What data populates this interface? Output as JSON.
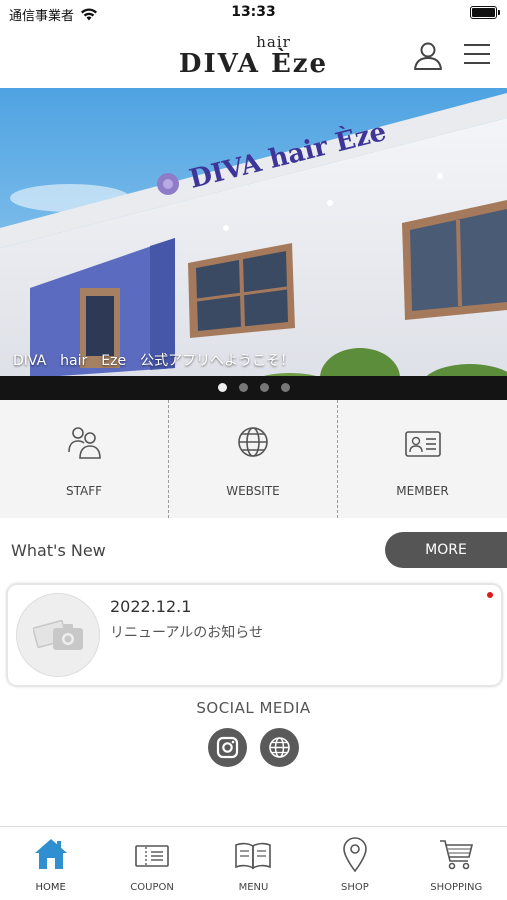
{
  "status_bar": {
    "carrier": "通信事業者",
    "time": "13:33"
  },
  "header": {
    "logo_small": "hair",
    "logo_main": "DIVA Èze"
  },
  "hero": {
    "sign_text": "DIVA hair Èze",
    "caption": "DIVA　hair　Eze　公式アプリへようこそ！",
    "slide_count": 4,
    "active_slide": 1
  },
  "quick_menu": [
    {
      "label": "STAFF",
      "icon": "staff-icon"
    },
    {
      "label": "WEBSITE",
      "icon": "globe-icon"
    },
    {
      "label": "MEMBER",
      "icon": "member-card-icon"
    }
  ],
  "whats_new": {
    "title": "What's New",
    "more_label": "MORE",
    "items": [
      {
        "date": "2022.12.1",
        "text": "リニューアルのお知らせ",
        "unread": true
      }
    ]
  },
  "social": {
    "title": "SOCIAL MEDIA",
    "links": [
      {
        "icon": "instagram-icon"
      },
      {
        "icon": "globe-icon"
      }
    ]
  },
  "tabbar": {
    "active": "HOME",
    "active_color": "#2f8fd0",
    "items": [
      {
        "label": "HOME",
        "icon": "home-icon"
      },
      {
        "label": "COUPON",
        "icon": "coupon-icon"
      },
      {
        "label": "MENU",
        "icon": "book-icon"
      },
      {
        "label": "SHOP",
        "icon": "map-pin-icon"
      },
      {
        "label": "SHOPPING",
        "icon": "cart-icon"
      }
    ]
  }
}
